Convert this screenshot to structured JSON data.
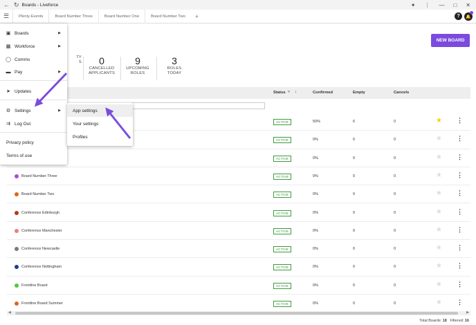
{
  "window": {
    "title": "Boards - Liveforce"
  },
  "tabs": [
    {
      "label": "Plenty Events"
    },
    {
      "label": "Board Number Three"
    },
    {
      "label": "Board Number One"
    },
    {
      "label": "Board Number Two"
    }
  ],
  "tab_add": "+",
  "help_label": "?",
  "new_board": "NEW BOARD",
  "stats": [
    {
      "number": "",
      "line1": "TY",
      "line2": "S"
    },
    {
      "number": "0",
      "line1": "CANCELLED",
      "line2": "APPLICANTS"
    },
    {
      "number": "9",
      "line1": "UPCOMING",
      "line2": "ROLES"
    },
    {
      "number": "3",
      "line1": "ROLES",
      "line2": "TODAY"
    }
  ],
  "table": {
    "headers": {
      "status": "Status",
      "confirmed": "Confirmed",
      "empty": "Empty",
      "cancels": "Cancels"
    },
    "rows": [
      {
        "name": "",
        "color": "",
        "status": "ACTIVE",
        "confirmed": "50%",
        "empty": "6",
        "cancels": "0",
        "starred": true
      },
      {
        "name": "",
        "color": "",
        "status": "ACTIVE",
        "confirmed": "0%",
        "empty": "0",
        "cancels": "0",
        "starred": false
      },
      {
        "name": "",
        "color": "",
        "status": "ACTIVE",
        "confirmed": "0%",
        "empty": "0",
        "cancels": "0",
        "starred": false
      },
      {
        "name": "Board Number Three",
        "color": "#b04ad6",
        "status": "ACTIVE",
        "confirmed": "0%",
        "empty": "0",
        "cancels": "0",
        "starred": false
      },
      {
        "name": "Board Number Two",
        "color": "#d86a1c",
        "status": "ACTIVE",
        "confirmed": "0%",
        "empty": "0",
        "cancels": "0",
        "starred": false
      },
      {
        "name": "Conference Edinburgh",
        "color": "#b23a1a",
        "status": "ACTIVE",
        "confirmed": "0%",
        "empty": "0",
        "cancels": "0",
        "starred": false
      },
      {
        "name": "Conference Manchester",
        "color": "#e8827a",
        "status": "ACTIVE",
        "confirmed": "0%",
        "empty": "0",
        "cancels": "0",
        "starred": false
      },
      {
        "name": "Conference Newcastle",
        "color": "#7a7a7a",
        "status": "ACTIVE",
        "confirmed": "0%",
        "empty": "0",
        "cancels": "0",
        "starred": false
      },
      {
        "name": "Conference Nottingham",
        "color": "#1d3f8f",
        "status": "ACTIVE",
        "confirmed": "0%",
        "empty": "0",
        "cancels": "0",
        "starred": false
      },
      {
        "name": "Frontline Board",
        "color": "#4fc93a",
        "status": "ACTIVE",
        "confirmed": "0%",
        "empty": "0",
        "cancels": "0",
        "starred": false
      },
      {
        "name": "Frontline Board Summer",
        "color": "#d86a1c",
        "status": "ACTIVE",
        "confirmed": "0%",
        "empty": "0",
        "cancels": "0",
        "starred": false
      }
    ]
  },
  "footer": {
    "total_label": "Total Boards:",
    "total": "18",
    "filtered_label": "Filtered:",
    "filtered": "16"
  },
  "menu": {
    "boards": "Boards",
    "workforce": "Workforce",
    "comms": "Comms",
    "pay": "Pay",
    "updates": "Updates",
    "settings": "Settings",
    "logout": "Log Out",
    "privacy": "Privacy policy",
    "terms": "Terms of use"
  },
  "submenu": {
    "app_settings": "App settings",
    "your_settings": "Your settings",
    "profiles": "Profiles"
  },
  "colors": {
    "accent": "#7b4bde",
    "active_status": "#2e8b2e",
    "star_on": "#f2d400"
  }
}
